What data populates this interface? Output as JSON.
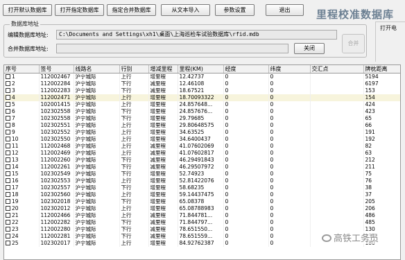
{
  "toolbar": {
    "open_default_label": "打开默认数据库",
    "open_specified_label": "打开指定数据库",
    "specify_merge_label": "指定合并数据库",
    "import_text_label": "从文本导入",
    "param_settings_label": "参数设置",
    "exit_label": "退出"
  },
  "app_title": "里程校准数据库",
  "db_group": {
    "legend": "数据库地址",
    "edit_label": "编辑数据库地址:",
    "edit_path": "C:\\Documents and Settings\\xh1\\桌面\\上海巡检车试验数据库\\rfid.mdb",
    "merge_label": "合并数据库地址:",
    "merge_path": "",
    "close_label": "关闭",
    "merge_label_btn": "合并"
  },
  "side_label": "打开电",
  "table": {
    "headers": [
      "序号",
      "签号",
      "线路名",
      "行别",
      "增减里程",
      "里程(KM)",
      "经度",
      "纬度",
      "交汇点",
      "牌枕距离"
    ],
    "rows": [
      [
        "1",
        "112002467",
        "沪宁城际",
        "上行",
        "增里程",
        "12.42737",
        "0",
        "0",
        "",
        "5194"
      ],
      [
        "2",
        "112002284",
        "沪宁城际",
        "下行",
        "减里程",
        "12.46108",
        "0",
        "0",
        "",
        "6197"
      ],
      [
        "3",
        "112002283",
        "沪宁城际",
        "下行",
        "减里程",
        "18.67521",
        "0",
        "0",
        "",
        "153"
      ],
      [
        "4",
        "112002471",
        "沪宁城际",
        "上行",
        "增里程",
        "18.70093322",
        "0",
        "0",
        "",
        "154"
      ],
      [
        "5",
        "102001415",
        "沪宁城际",
        "上行",
        "增里程",
        "24.857648...",
        "0",
        "0",
        "",
        "424"
      ],
      [
        "6",
        "102302558",
        "沪宁城际",
        "下行",
        "增里程",
        "24.857676...",
        "0",
        "0",
        "",
        "423"
      ],
      [
        "7",
        "102302558",
        "沪宁城际",
        "下行",
        "增里程",
        "29.79685",
        "0",
        "0",
        "",
        "65"
      ],
      [
        "8",
        "102302551",
        "沪宁城际",
        "上行",
        "增里程",
        "29.80648575",
        "0",
        "0",
        "",
        "66"
      ],
      [
        "9",
        "102302552",
        "沪宁城际",
        "上行",
        "增里程",
        "34.63525",
        "0",
        "0",
        "",
        "191"
      ],
      [
        "10",
        "102302550",
        "沪宁城际",
        "上行",
        "增里程",
        "34.6400437",
        "0",
        "0",
        "",
        "192"
      ],
      [
        "11",
        "112002468",
        "沪宁城际",
        "上行",
        "减里程",
        "41.07602069",
        "0",
        "0",
        "",
        "82"
      ],
      [
        "12",
        "112002469",
        "沪宁城际",
        "上行",
        "减里程",
        "41.07602817",
        "0",
        "0",
        "",
        "63"
      ],
      [
        "13",
        "112002260",
        "沪宁城际",
        "下行",
        "减里程",
        "46.29491843",
        "0",
        "0",
        "",
        "212"
      ],
      [
        "14",
        "112002261",
        "沪宁城际",
        "下行",
        "减里程",
        "46.29507972",
        "0",
        "0",
        "",
        "211"
      ],
      [
        "15",
        "102302549",
        "沪宁城际",
        "下行",
        "增里程",
        "52.74923",
        "0",
        "0",
        "",
        "75"
      ],
      [
        "16",
        "102302553",
        "沪宁城际",
        "上行",
        "增里程",
        "52.81422076",
        "0",
        "0",
        "",
        "76"
      ],
      [
        "17",
        "102302557",
        "沪宁城际",
        "下行",
        "增里程",
        "58.68235",
        "0",
        "0",
        "",
        "38"
      ],
      [
        "18",
        "102302560",
        "沪宁城际",
        "上行",
        "增里程",
        "59.14437475",
        "0",
        "0",
        "",
        "37"
      ],
      [
        "19",
        "102302018",
        "沪宁城际",
        "下行",
        "增里程",
        "65.08378",
        "0",
        "0",
        "",
        "205"
      ],
      [
        "20",
        "102302012",
        "沪宁城际",
        "上行",
        "增里程",
        "65.08788983",
        "0",
        "0",
        "",
        "206"
      ],
      [
        "21",
        "112002466",
        "沪宁城际",
        "上行",
        "减里程",
        "71.844781...",
        "0",
        "0",
        "",
        "486"
      ],
      [
        "22",
        "112002282",
        "沪宁城际",
        "下行",
        "减里程",
        "71.844797...",
        "0",
        "0",
        "",
        "485"
      ],
      [
        "23",
        "112002280",
        "沪宁城际",
        "下行",
        "减里程",
        "78.651550...",
        "0",
        "0",
        "",
        "130"
      ],
      [
        "24",
        "112002281",
        "沪宁城际",
        "下行",
        "减里程",
        "78.651559...",
        "0",
        "0",
        "",
        "131"
      ],
      [
        "25",
        "102302017",
        "沪宁城际",
        "上行",
        "增里程",
        "84.92762387",
        "0",
        "0",
        "",
        "180"
      ]
    ]
  },
  "watermark": "高铁工务员"
}
